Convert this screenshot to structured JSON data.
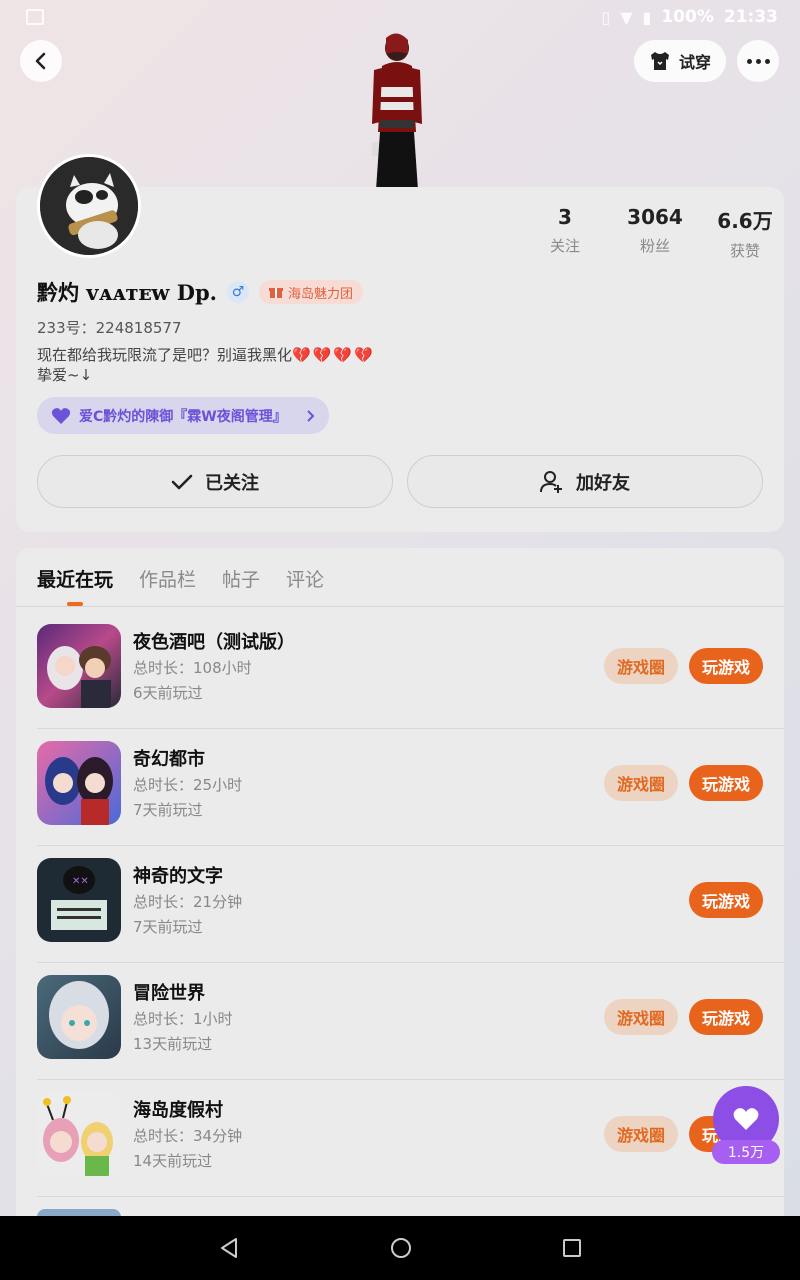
{
  "status_bar": {
    "battery": "100%",
    "time": "21:33"
  },
  "top": {
    "try_on_label": "试穿"
  },
  "profile": {
    "stats": [
      {
        "num": "3",
        "label": "关注"
      },
      {
        "num": "3064",
        "label": "粉丝"
      },
      {
        "num": "6.6万",
        "label": "获赞"
      }
    ],
    "name": "黔灼 ᴠᴀᴀᴛᴇᴡ Dp.",
    "gender_symbol": "♂",
    "tag": "海岛魅力团",
    "uid": "233号：224818577",
    "bio_line1": "现在都给我玩限流了是吧？别逼我黑化",
    "bio_hearts": "💔💔💔💔",
    "bio_line2": "挚爱~↓",
    "guard_text": "爱C黔灼的陳御『霖W夜阁管理』",
    "follow_label": "已关注",
    "add_friend_label": "加好友"
  },
  "tabs": [
    {
      "label": "最近在玩"
    },
    {
      "label": "作品栏"
    },
    {
      "label": "帖子"
    },
    {
      "label": "评论"
    }
  ],
  "games": [
    {
      "title": "夜色酒吧（测试版）",
      "duration": "总时长：108小时",
      "last": "6天前玩过",
      "circle": "游戏圈",
      "play": "玩游戏"
    },
    {
      "title": "奇幻都市",
      "duration": "总时长：25小时",
      "last": "7天前玩过",
      "circle": "游戏圈",
      "play": "玩游戏"
    },
    {
      "title": "神奇的文字",
      "duration": "总时长：21分钟",
      "last": "7天前玩过",
      "circle": "",
      "play": "玩游戏"
    },
    {
      "title": "冒险世界",
      "duration": "总时长：1小时",
      "last": "13天前玩过",
      "circle": "游戏圈",
      "play": "玩游戏"
    },
    {
      "title": "海岛度假村",
      "duration": "总时长：34分钟",
      "last": "14天前玩过",
      "circle": "游戏圈",
      "play": "玩游戏"
    }
  ],
  "like": {
    "count": "1.5万"
  },
  "colors": {
    "accent": "#e8631b",
    "purple": "#8d4ee6"
  }
}
